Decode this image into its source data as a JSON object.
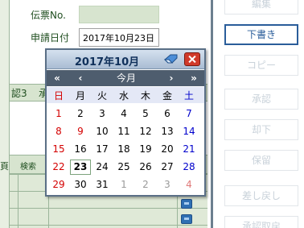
{
  "form": {
    "slip_no_label": "伝票No.",
    "request_date_label": "申請日付",
    "request_date_value": "2017年10月23日",
    "header_fragment_1": "認3",
    "header_fragment_2": "承",
    "column_fragment": "頁",
    "search_label": "検索"
  },
  "right_panel": {
    "buttons": [
      "編集",
      "下書き",
      "コピー",
      "承認",
      "却下",
      "保留",
      "差し戻し",
      "承認取戻"
    ]
  },
  "calendar": {
    "title": "2017年10月",
    "nav": {
      "prev_year": "«",
      "prev_month": "‹",
      "this_month": "今月",
      "next_month": "›",
      "next_year": "»"
    },
    "weekdays": [
      "日",
      "月",
      "火",
      "水",
      "木",
      "金",
      "土"
    ],
    "weeks": [
      [
        1,
        2,
        3,
        4,
        5,
        6,
        7
      ],
      [
        8,
        9,
        10,
        11,
        12,
        13,
        14
      ],
      [
        15,
        16,
        17,
        18,
        19,
        20,
        21
      ],
      [
        22,
        23,
        24,
        25,
        26,
        27,
        28
      ],
      [
        29,
        30,
        31,
        1,
        2,
        3,
        4
      ]
    ],
    "selected_day": 23,
    "colors": {
      "sunday": "#d40000",
      "saturday": "#0000cc",
      "other_month": "#9a9a9a",
      "header": "#4e5d6e"
    },
    "icons": {
      "clear": "eraser-icon",
      "close": "close-icon"
    }
  }
}
